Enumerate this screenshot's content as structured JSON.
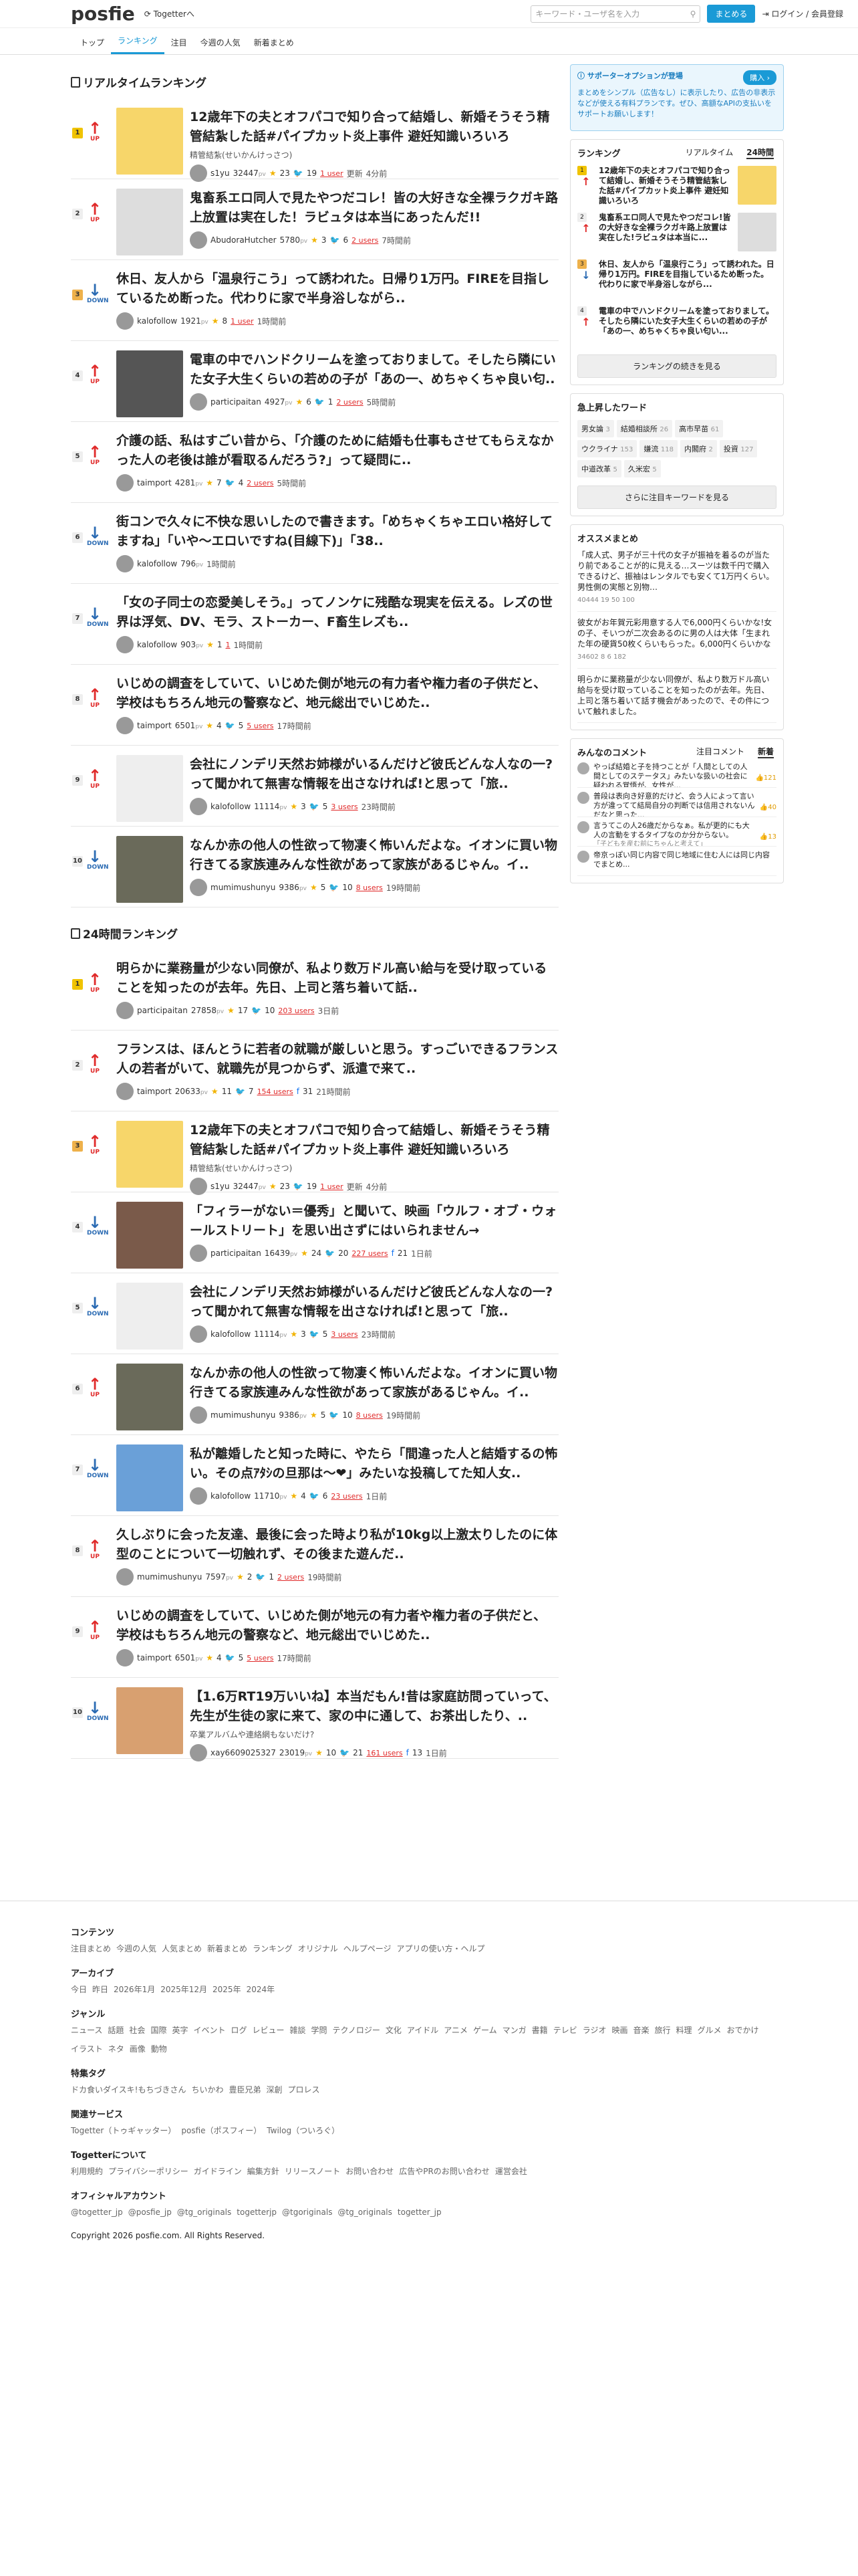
{
  "header": {
    "logo": "posfie",
    "togetter_label": "Togetterへ",
    "search_placeholder": "キーワード・ユーザ名を入力",
    "matome_button": "まとめる",
    "login": "ログイン / 会員登録"
  },
  "nav": [
    "トップ",
    "ランキング",
    "注目",
    "今週の人気",
    "新着まとめ"
  ],
  "realtime": {
    "title": "リアルタイムランキング",
    "items": [
      {
        "rank": "1",
        "dir": "UP",
        "title": "12歳年下の夫とオフパコで知り合って結婚し、新婚そうそう精管結紮した話#パイプカット炎上事件 避妊知識いろいろ",
        "sub": "精管結紮(せいかんけっさつ)",
        "user": "s1yu",
        "pt": "32447",
        "stars": "23",
        "tw": "19",
        "users": "1 user",
        "extra": "更新",
        "time": "4分前",
        "thumb": true,
        "tc": "#f7d66a"
      },
      {
        "rank": "2",
        "dir": "UP",
        "title": "鬼畜系エロ同人で見たやつだコレ！皆の大好きな全裸ラクガキ路上放置は実在した！ラビュタは本当にあったんだ!!",
        "sub": "",
        "user": "AbudoraHutcher",
        "pt": "5780",
        "stars": "3",
        "tw": "6",
        "users": "2 users",
        "extra": "",
        "time": "7時間前",
        "thumb": true,
        "tc": "#ddd"
      },
      {
        "rank": "3",
        "dir": "DOWN",
        "title": "休日、友人から「温泉行こう」って誘われた。日帰り1万円。FIREを目指しているため断った。代わりに家で半身浴しながら..",
        "sub": "",
        "user": "kalofollow",
        "pt": "1921",
        "stars": "8",
        "tw": "",
        "users": "1 user",
        "extra": "",
        "time": "1時間前",
        "thumb": false,
        "tc": ""
      },
      {
        "rank": "4",
        "dir": "UP",
        "title": "電車の中でハンドクリームを塗っておりまして。そしたら隣にいた女子大生くらいの若めの子が「あの一、めちゃくちゃ良い匂..",
        "sub": "",
        "user": "participaitan",
        "pt": "4927",
        "stars": "6",
        "tw": "1",
        "users": "2 users",
        "extra": "",
        "time": "5時間前",
        "thumb": true,
        "tc": "#555"
      },
      {
        "rank": "5",
        "dir": "UP",
        "title": "介護の話、私はすごい昔から、「介護のために結婚も仕事もさせてもらえなかった人の老後は誰が看取るんだろう?」って疑問に..",
        "sub": "",
        "user": "taimport",
        "pt": "4281",
        "stars": "7",
        "tw": "4",
        "users": "2 users",
        "extra": "",
        "time": "5時間前",
        "thumb": false,
        "tc": ""
      },
      {
        "rank": "6",
        "dir": "DOWN",
        "title": "街コンで久々に不快な思いしたので書きます。「めちゃくちゃエロい格好してますね」「いや〜エロいですね(目線下)」「38..",
        "sub": "",
        "user": "kalofollow",
        "pt": "796",
        "stars": "",
        "tw": "",
        "users": "",
        "extra": "",
        "time": "1時間前",
        "thumb": false,
        "tc": ""
      },
      {
        "rank": "7",
        "dir": "DOWN",
        "title": "「女の子同士の恋愛美しそう。」ってノンケに残酷な現実を伝える。レズの世界は浮気、DV、モラ、ストーカー、F畜生レズも..",
        "sub": "",
        "user": "kalofollow",
        "pt": "903",
        "stars": "1",
        "tw": "",
        "users": "1",
        "extra": "",
        "time": "1時間前",
        "thumb": false,
        "tc": ""
      },
      {
        "rank": "8",
        "dir": "UP",
        "title": "いじめの調査をしていて、いじめた側が地元の有力者や権力者の子供だと、学校はもちろん地元の警察など、地元総出でいじめた..",
        "sub": "",
        "user": "taimport",
        "pt": "6501",
        "stars": "4",
        "tw": "5",
        "users": "5 users",
        "extra": "",
        "time": "17時間前",
        "thumb": false,
        "tc": ""
      },
      {
        "rank": "9",
        "dir": "UP",
        "title": "会社にノンデリ天然お姉様がいるんだけど彼氏どんな人なの一?って聞かれて無害な情報を出さなければ!と思って「旅..",
        "sub": "",
        "user": "kalofollow",
        "pt": "11114",
        "stars": "3",
        "tw": "5",
        "users": "3 users",
        "extra": "",
        "time": "23時間前",
        "thumb": true,
        "tc": "#eee"
      },
      {
        "rank": "10",
        "dir": "DOWN",
        "title": "なんか赤の他人の性欲って物凄く怖いんだよな。イオンに買い物行きてる家族連みんな性欲があって家族があるじゃん。イ..",
        "sub": "",
        "user": "mumimushunyu",
        "pt": "9386",
        "stars": "5",
        "tw": "10",
        "users": "8 users",
        "extra": "",
        "time": "19時間前",
        "thumb": true,
        "tc": "#6a6a5a"
      }
    ]
  },
  "daily": {
    "title": "24時間ランキング",
    "items": [
      {
        "rank": "1",
        "dir": "UP",
        "title": "明らかに業務量が少ない同僚が、私より数万ドル高い給与を受け取っていることを知ったのが去年。先日、上司と落ち着いて話..",
        "sub": "",
        "user": "participaitan",
        "pt": "27858",
        "stars": "17",
        "tw": "10",
        "users": "203 users",
        "fb": "",
        "extra": "",
        "time": "3日前",
        "thumb": false,
        "tc": ""
      },
      {
        "rank": "2",
        "dir": "UP",
        "title": "フランスは、ほんとうに若者の就職が厳しいと思う。すっごいできるフランス人の若者がいて、就職先が見つからず、派遣で来て..",
        "sub": "",
        "user": "taimport",
        "pt": "20633",
        "stars": "11",
        "tw": "7",
        "users": "154 users",
        "fb": "31",
        "extra": "",
        "time": "21時間前",
        "thumb": false,
        "tc": ""
      },
      {
        "rank": "3",
        "dir": "UP",
        "title": "12歳年下の夫とオフパコで知り合って結婚し、新婚そうそう精管結紮した話#パイプカット炎上事件 避妊知識いろいろ",
        "sub": "精管結紮(せいかんけっさつ)",
        "user": "s1yu",
        "pt": "32447",
        "stars": "23",
        "tw": "19",
        "users": "1 user",
        "fb": "",
        "extra": "更新",
        "time": "4分前",
        "thumb": true,
        "tc": "#f7d66a"
      },
      {
        "rank": "4",
        "dir": "DOWN",
        "title": "「フィラーがない＝優秀」と聞いて、映画「ウルフ・オブ・ウォールストリート」を思い出さずにはいられません→",
        "sub": "",
        "user": "participaitan",
        "pt": "16439",
        "stars": "24",
        "tw": "20",
        "users": "227 users",
        "fb": "21",
        "extra": "",
        "time": "1日前",
        "thumb": true,
        "tc": "#7a5a4a"
      },
      {
        "rank": "5",
        "dir": "DOWN",
        "title": "会社にノンデリ天然お姉様がいるんだけど彼氏どんな人なの一?って聞かれて無害な情報を出さなければ!と思って「旅..",
        "sub": "",
        "user": "kalofollow",
        "pt": "11114",
        "stars": "3",
        "tw": "5",
        "users": "3 users",
        "fb": "",
        "extra": "",
        "time": "23時間前",
        "thumb": true,
        "tc": "#eee"
      },
      {
        "rank": "6",
        "dir": "UP",
        "title": "なんか赤の他人の性欲って物凄く怖いんだよな。イオンに買い物行きてる家族連みんな性欲があって家族があるじゃん。イ..",
        "sub": "",
        "user": "mumimushunyu",
        "pt": "9386",
        "stars": "5",
        "tw": "10",
        "users": "8 users",
        "fb": "",
        "extra": "",
        "time": "19時間前",
        "thumb": true,
        "tc": "#6a6a5a"
      },
      {
        "rank": "7",
        "dir": "DOWN",
        "title": "私が離婚したと知った時に、やたら「間違った人と結婚するの怖い。その点ｱﾀｼの旦那は〜❤」みたいな投稿してた知人女..",
        "sub": "",
        "user": "kalofollow",
        "pt": "11710",
        "stars": "4",
        "tw": "6",
        "users": "23 users",
        "fb": "",
        "extra": "",
        "time": "1日前",
        "thumb": true,
        "tc": "#6aa0d8"
      },
      {
        "rank": "8",
        "dir": "UP",
        "title": "久しぶりに会った友達、最後に会った時より私が10kg以上激太りしたのに体型のことについて一切触れず、その後また遊んだ..",
        "sub": "",
        "user": "mumimushunyu",
        "pt": "7597",
        "stars": "2",
        "tw": "1",
        "users": "2 users",
        "fb": "",
        "extra": "",
        "time": "19時間前",
        "thumb": false,
        "tc": ""
      },
      {
        "rank": "9",
        "dir": "UP",
        "title": "いじめの調査をしていて、いじめた側が地元の有力者や権力者の子供だと、学校はもちろん地元の警察など、地元総出でいじめた..",
        "sub": "",
        "user": "taimport",
        "pt": "6501",
        "stars": "4",
        "tw": "5",
        "users": "5 users",
        "fb": "",
        "extra": "",
        "time": "17時間前",
        "thumb": false,
        "tc": ""
      },
      {
        "rank": "10",
        "dir": "DOWN",
        "title": "【1.6万RT19万いいね】本当だもん!昔は家庭訪問っていって、先生が生徒の家に来て、家の中に通して、お茶出したり、..",
        "sub": "卒業アルバムや連絡網もないだけ?",
        "user": "xay6609025327",
        "pt": "23019",
        "stars": "10",
        "tw": "21",
        "users": "161 users",
        "fb": "13",
        "extra": "",
        "time": "1日前",
        "thumb": true,
        "tc": "#d8a070"
      }
    ]
  },
  "side": {
    "promo_title": "サポーターオプションが登場",
    "promo_btn": "購入 ›",
    "promo_desc": "まとめをシンプル（広告なし）に表示したり、広告の非表示などが使える有料プランです。ぜひ、高額なAPIの支払いをサポートお願いします！",
    "ranking_title": "ランキング",
    "tab1": "リアルタイム",
    "tab2": "24時間",
    "rk": [
      {
        "n": "1",
        "t": "12歳年下の夫とオフパコで知り合って結婚し、新婚そうそう精管結紮した話#パイプカット炎上事件 避妊知識いろいろ"
      },
      {
        "n": "2",
        "t": "鬼畜系エロ同人で見たやつだコレ!皆の大好きな全裸ラクガキ路上放置は実在した!ラビュタは本当に..."
      },
      {
        "n": "3",
        "t": "休日、友人から「温泉行こう」って誘われた。日帰り1万円。FIREを目指しているため断った。代わりに家で半身浴しながら..."
      },
      {
        "n": "4",
        "t": "電車の中でハンドクリームを塗っておりまして。そしたら隣にいた女子大生くらいの若めの子が「あの一、めちゃくちゃ良い匂い..."
      }
    ],
    "rk_btn": "ランキングの続きを見る",
    "kw_title": "急上昇したワード",
    "kw": [
      [
        "男女論",
        "3"
      ],
      [
        "結婚相談所",
        "26"
      ],
      [
        "高市早苗",
        "61"
      ],
      [
        "ウクライナ",
        "153"
      ],
      [
        "嫌流",
        "118"
      ],
      [
        "内閣府",
        "2"
      ],
      [
        "投資",
        "127"
      ],
      [
        "中道改革",
        "5"
      ],
      [
        "久米宏",
        "5"
      ]
    ],
    "kw_btn": "さらに注目キーワードを見る",
    "osu_title": "オススメまとめ",
    "osu": [
      {
        "t": "「成人式、男子が三十代の女子が振袖を着るのが当たり前であることが的に見える…スーツは数千円で購入できるけど、振袖はレンタルでも安くて1万円くらい。男性側の実態と別物…",
        "m": "40444 19 50 100"
      },
      {
        "t": "彼女がお年賀元彩用意する人で6,000円くらいかな!女の子、そいつが二次会あるのに男の人は大体「生まれた年の硬貨50枚くらいもらった。6,000円くらいかな",
        "m": "34602 8 6 182"
      },
      {
        "t": "明らかに業務量が少ない同僚が、私より数万ドル高い給与を受け取っていることを知ったのが去年。先日、上司と落ち着いて話す機会があったので、その件について触れました。",
        "m": ""
      }
    ],
    "cm_title": "みんなのコメント",
    "cm_tab1": "注目コメント",
    "cm_tab2": "新着",
    "cm": [
      {
        "t": "やっぱ結婚と子を持つことが「人間としての人間としてのステータス」みたいな扱いの社会に疑われる覚悟が、女性が...",
        "q": "「子どもを産む前にちゃんと考えて」",
        "c": "121"
      },
      {
        "t": "普段は表向き好意的だけど、会う人によって言い方が違ってて結局自分の判断では信用されないんだなと思った...",
        "q": "高山のみなさんへ...",
        "c": "40"
      },
      {
        "t": "言うてこの人26歳だからなぁ。私が更的にも大人の言動をするタイプなのか分からない。",
        "q": "「子どもを産む前にちゃんと考えて」",
        "c": "13"
      },
      {
        "t": "帝京っぽい同じ内容で同じ地域に住む人には同じ内容でまとめ...",
        "q": "",
        "c": ""
      }
    ]
  },
  "footer": {
    "contents_title": "コンテンツ",
    "contents": [
      "注目まとめ",
      "今週の人気",
      "人気まとめ",
      "新着まとめ",
      "ランキング",
      "オリジナル",
      "ヘルプページ",
      "アプリの使い方・ヘルプ"
    ],
    "archive_title": "アーカイブ",
    "archive": [
      "今日",
      "昨日",
      "2026年1月",
      "2025年12月",
      "2025年",
      "2024年"
    ],
    "genre_title": "ジャンル",
    "genre": [
      "ニュース",
      "話題",
      "社会",
      "国際",
      "英字",
      "イベント",
      "ログ",
      "レビュー",
      "雑談",
      "学問",
      "テクノロジー",
      "文化",
      "アイドル",
      "アニメ",
      "ゲーム",
      "マンガ",
      "書籍",
      "テレビ",
      "ラジオ",
      "映画",
      "音楽",
      "旅行",
      "料理",
      "グルメ",
      "おでかけ",
      "イラスト",
      "ネタ",
      "画像",
      "動物"
    ],
    "tag_title": "特集タグ",
    "tags": [
      "ドカ食いダイスキ!もちづきさん",
      "ちいかわ",
      "豊臣兄弟",
      "深創",
      "プロレス"
    ],
    "rel_title": "関連サービス",
    "rel": [
      "Togetter（トゥギャッター）",
      "posfie（ポスフィー）",
      "Twilog（ついろぐ）"
    ],
    "about_title": "Togetterについて",
    "about": [
      "利用規約",
      "プライバシーポリシー",
      "ガイドライン",
      "編集方針",
      "リリースノート",
      "お問い合わせ",
      "広告やPRのお問い合わせ",
      "運営会社"
    ],
    "sns_title": "オフィシャルアカウント",
    "sns": [
      "@togetter_jp",
      "@posfie_jp",
      "@tg_originals",
      "togetterjp",
      "@tgoriginals",
      "@tg_originals",
      "togetter_jp"
    ],
    "copyright": "Copyright 2026 posfie.com. All Rights Reserved."
  }
}
